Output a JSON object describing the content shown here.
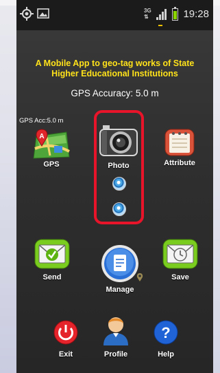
{
  "status_bar": {
    "time": "19:28",
    "network": "3G",
    "icons": [
      "gps-icon",
      "image-icon",
      "signal-icon",
      "battery-icon"
    ]
  },
  "header": {
    "title_line1": "A Mobile App to geo-tag works of State",
    "title_line2": "Higher Educational Institutions",
    "gps_accuracy": "GPS Accuracy: 5.0 m"
  },
  "gps_tile": {
    "accuracy_small": "GPS Acc:5.0 m",
    "label": "GPS"
  },
  "photo_tile": {
    "label": "Photo"
  },
  "attribute_tile": {
    "label": "Attribute"
  },
  "send_tile": {
    "label": "Send"
  },
  "manage_tile": {
    "label": "Manage"
  },
  "save_tile": {
    "label": "Save"
  },
  "exit_tile": {
    "label": "Exit"
  },
  "profile_tile": {
    "label": "Profile"
  },
  "help_tile": {
    "label": "Help"
  },
  "colors": {
    "title": "#ffe21a",
    "highlight_frame": "#e8142a",
    "accent_green": "#6cc11c",
    "accent_blue": "#2a6fd6"
  }
}
